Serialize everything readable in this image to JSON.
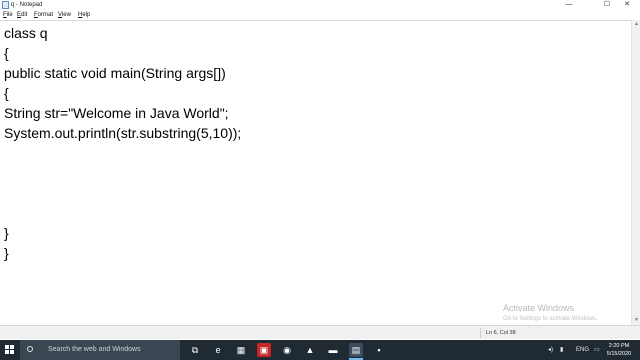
{
  "window": {
    "title": "q - Notepad",
    "controls": {
      "minimize": "—",
      "maximize": "☐",
      "close": "✕"
    }
  },
  "menu": {
    "items": [
      {
        "key": "F",
        "rest": "ile"
      },
      {
        "key": "E",
        "rest": "dit"
      },
      {
        "key": "F",
        "rest": "ormat"
      },
      {
        "key": "V",
        "rest": "iew"
      },
      {
        "key": "H",
        "rest": "elp"
      }
    ]
  },
  "editor": {
    "lines": [
      "class q",
      "{",
      "public static void main(String args[])",
      "{",
      "String str=\"Welcome in Java World\";",
      "System.out.println(str.substring(5,10));",
      "",
      "",
      "",
      "",
      "}",
      "}"
    ]
  },
  "status": {
    "position": "Ln 6, Col 38"
  },
  "watermark": {
    "title": "Activate Windows",
    "subtitle": "Go to Settings to activate Windows."
  },
  "taskbar": {
    "search_placeholder": "Search the web and Windows",
    "apps": [
      {
        "icon": "task-view-icon",
        "glyph": "⧉",
        "color": "#1f2a33"
      },
      {
        "icon": "edge-icon",
        "glyph": "e",
        "color": "#1f2a33"
      },
      {
        "icon": "store-icon",
        "glyph": "▦",
        "color": "#1f2a33"
      },
      {
        "icon": "pdf-icon",
        "glyph": "▣",
        "color": "#c62828"
      },
      {
        "icon": "firefox-icon",
        "glyph": "◉",
        "color": "#1f2a33"
      },
      {
        "icon": "vlc-icon",
        "glyph": "▲",
        "color": "#1f2a33"
      },
      {
        "icon": "file-explorer-icon",
        "glyph": "▬",
        "color": "#1f2a33"
      },
      {
        "icon": "notepad-icon",
        "glyph": "▤",
        "color": "#3a4c5e"
      },
      {
        "icon": "terminal-icon",
        "glyph": "▪",
        "color": "#1f2a33"
      }
    ],
    "language": "ENG",
    "time": "2:20 PM",
    "date": "5/15/2020"
  },
  "colors": {
    "taskbar": "#1f2a33",
    "search_box": "#3a4652",
    "accent": "#76b9ed"
  }
}
